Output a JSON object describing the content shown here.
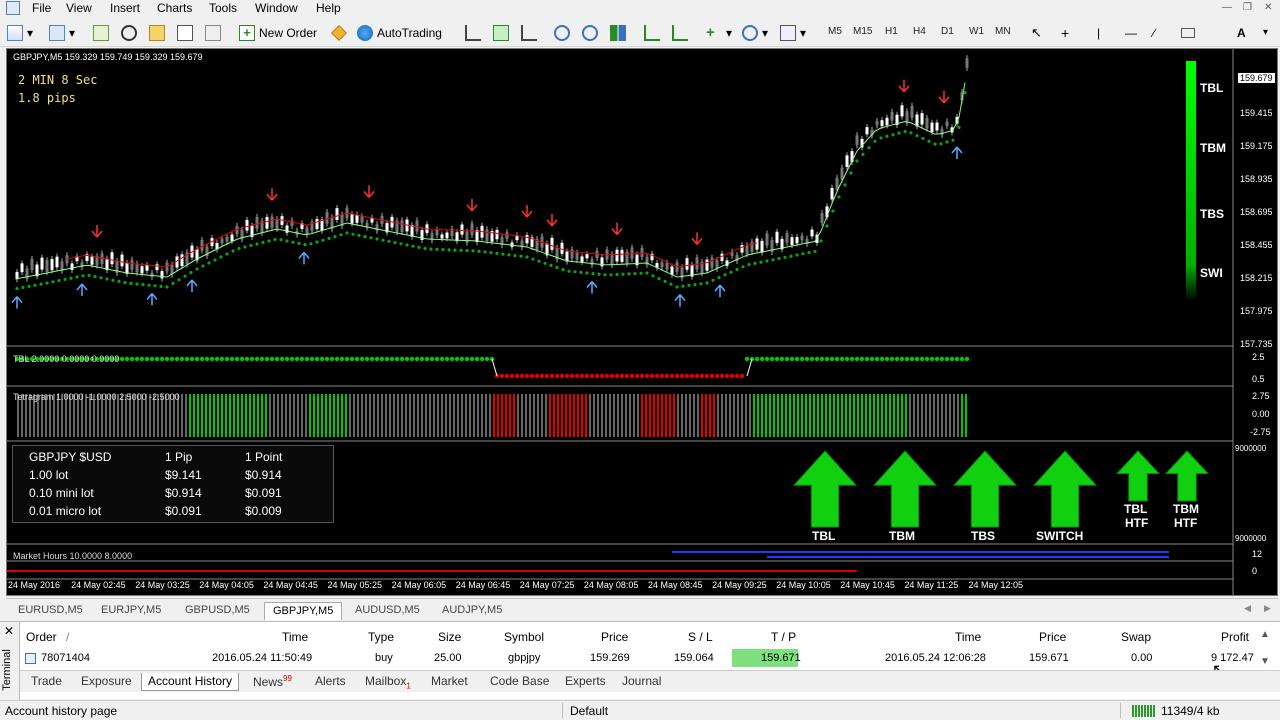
{
  "menu": {
    "items": [
      "File",
      "View",
      "Insert",
      "Charts",
      "Tools",
      "Window",
      "Help"
    ]
  },
  "toolbar": {
    "new_order": "New Order",
    "autotrading": "AutoTrading",
    "timeframes": [
      "M5",
      "M15",
      "H1",
      "H4",
      "D1",
      "W1",
      "MN"
    ]
  },
  "chart": {
    "header": "GBPJPY,M5  159.329 159.749 159.329 159.679",
    "timer": "2 MIN 8 Sec",
    "spread": "1.8 pips",
    "signals": [
      "TBL",
      "TBM",
      "TBS",
      "SWI"
    ],
    "price_current": "159.679",
    "price_axis": [
      "159.415",
      "159.175",
      "158.935",
      "158.695",
      "158.455",
      "158.215",
      "157.975",
      "157.735"
    ],
    "ind1_label": "TBL 2.0000 0.0000 0.0000",
    "ind1_axis": [
      "2.5",
      "0.5"
    ],
    "ind2_label": "Tetragram 1.0000 -1.0000 2.5000 -2.5000",
    "ind2_axis": [
      "2.75",
      "0.00",
      "-2.75"
    ],
    "ind3_axis": [
      "9000000",
      "9000000"
    ],
    "pip_table": {
      "rows": [
        [
          "GBPJPY $USD",
          "1 Pip",
          "1 Point"
        ],
        [
          "1.00 lot",
          "$9.141",
          "$0.914"
        ],
        [
          "0.10 mini lot",
          "$0.914",
          "$0.091"
        ],
        [
          "0.01 micro lot",
          "$0.091",
          "$0.009"
        ]
      ]
    },
    "arrows": [
      {
        "label": "TBL",
        "sub": ""
      },
      {
        "label": "TBM",
        "sub": ""
      },
      {
        "label": "TBS",
        "sub": ""
      },
      {
        "label": "SWITCH",
        "sub": ""
      },
      {
        "label": "TBL",
        "sub": "HTF"
      },
      {
        "label": "TBM",
        "sub": "HTF"
      }
    ],
    "market_hours_label": "Market Hours 10.0000 8.0000",
    "ind4_axis": [
      "12",
      "0"
    ],
    "time_axis": [
      "24 May 2016",
      "24 May 02:45",
      "24 May 03:25",
      "24 May 04:05",
      "24 May 04:45",
      "24 May 05:25",
      "24 May 06:05",
      "24 May 06:45",
      "24 May 07:25",
      "24 May 08:05",
      "24 May 08:45",
      "24 May 09:25",
      "24 May 10:05",
      "24 May 10:45",
      "24 May 11:25",
      "24 May 12:05"
    ]
  },
  "symbol_tabs": [
    "EURUSD,M5",
    "EURJPY,M5",
    "GBPUSD,M5",
    "GBPJPY,M5",
    "AUDUSD,M5",
    "AUDJPY,M5"
  ],
  "active_symbol_tab": "GBPJPY,M5",
  "terminal": {
    "side_label": "Terminal",
    "headers": {
      "order": "Order",
      "slash": "/",
      "time": "Time",
      "type": "Type",
      "size": "Size",
      "symbol": "Symbol",
      "price": "Price",
      "sl": "S / L",
      "tp": "T / P",
      "time2": "Time",
      "price2": "Price",
      "swap": "Swap",
      "profit": "Profit"
    },
    "row": {
      "order": "78071404",
      "time": "2016.05.24 11:50:49",
      "type": "buy",
      "size": "25.00",
      "symbol": "gbpjpy",
      "price": "159.269",
      "sl": "159.064",
      "tp": "159.671",
      "time2": "2016.05.24 12:06:28",
      "price2": "159.671",
      "swap": "0.00",
      "profit": "9 172.47"
    },
    "tabs": [
      "Trade",
      "Exposure",
      "Account History",
      "News",
      "Alerts",
      "Mailbox",
      "Market",
      "Code Base",
      "Experts",
      "Journal"
    ],
    "active_tab": "Account History",
    "news_badge": "99",
    "mailbox_badge": "1"
  },
  "status": {
    "left": "Account history page",
    "profile": "Default",
    "memory": "11349/4 kb"
  },
  "colors": {
    "green": "#00c800",
    "red": "#e00000",
    "tp_bg": "#7fe07f"
  }
}
